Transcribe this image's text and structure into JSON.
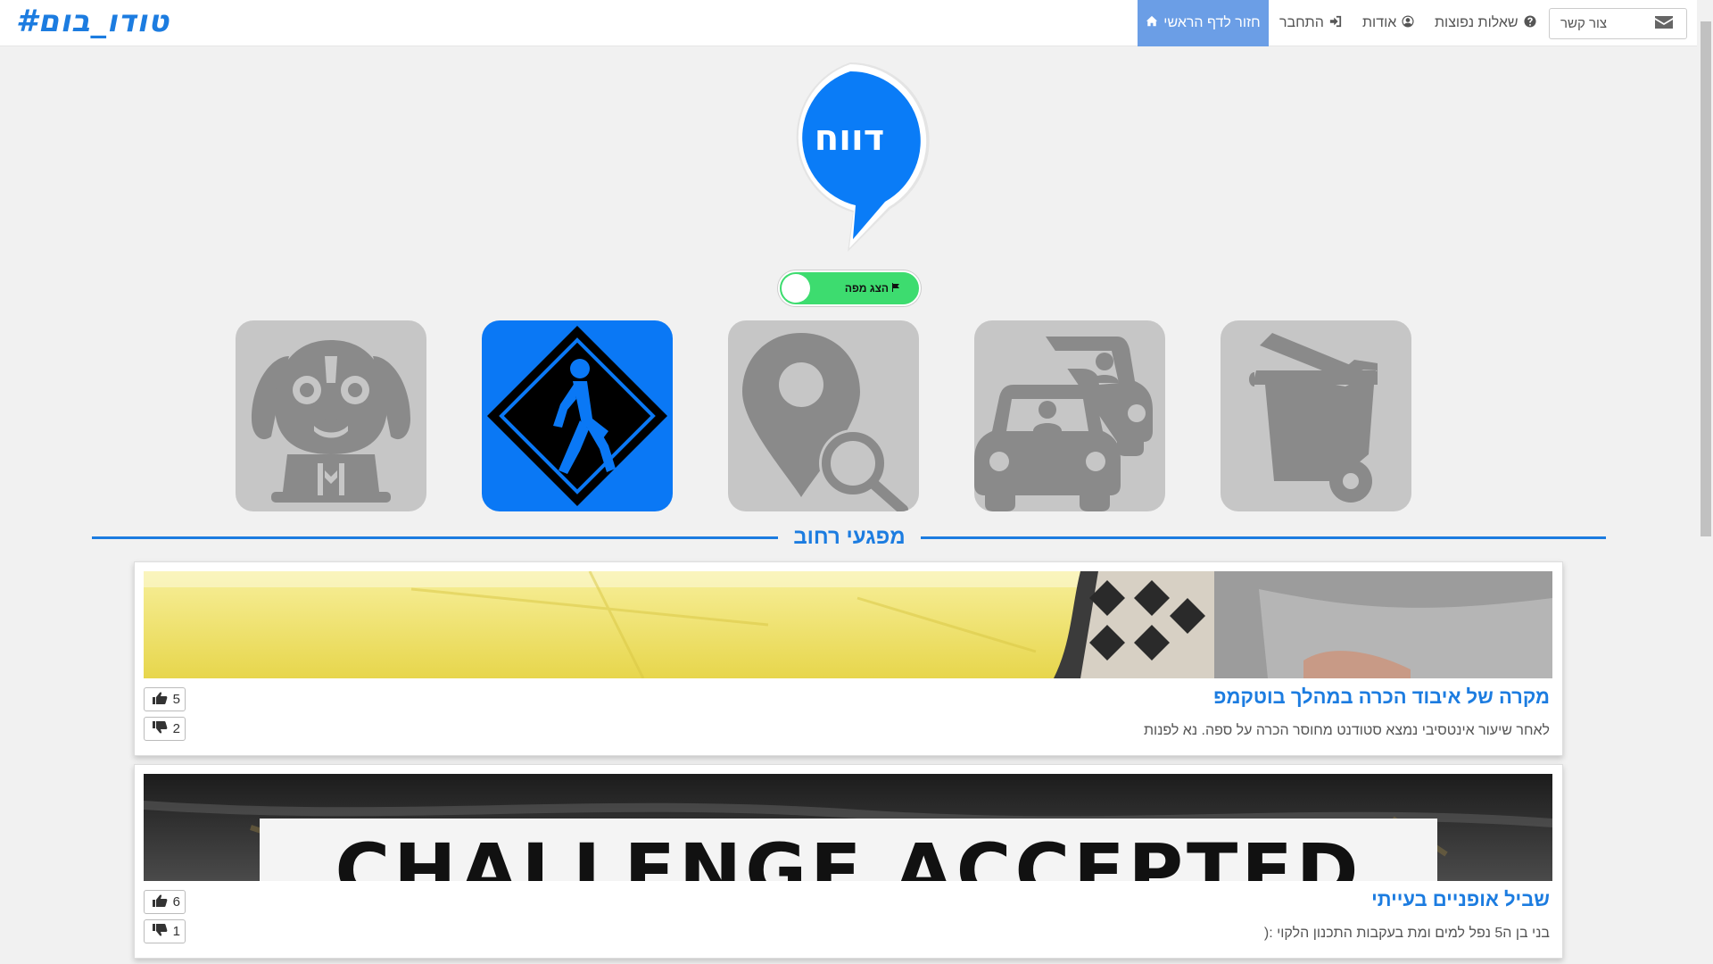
{
  "brand": {
    "logo_text": "#טודו_בום"
  },
  "nav": {
    "contact_label": "צור קשר",
    "faq_label": "שאלות נפוצות",
    "about_label": "אודות",
    "login_label": "התחבר",
    "home_label": "חזור לדף הראשי"
  },
  "hero": {
    "bubble_text": "דווח",
    "map_toggle_label": "הצג מפה",
    "map_toggle_on": false
  },
  "categories": [
    {
      "name": "dog",
      "icon": "dog-icon",
      "active": false
    },
    {
      "name": "pedestrian",
      "icon": "pedestrian-sign-icon",
      "active": true
    },
    {
      "name": "location",
      "icon": "location-search-icon",
      "active": false
    },
    {
      "name": "traffic",
      "icon": "cars-icon",
      "active": false
    },
    {
      "name": "trash",
      "icon": "trash-bin-icon",
      "active": false
    }
  ],
  "section": {
    "title": "מפגעי רחוב"
  },
  "reports": [
    {
      "title": "מקרה של איבוד הכרה במהלך בוטקמפ",
      "description": "לאחר שיעור אינטסיבי נמצא סטודנט מחוסר הכרה על ספה. נא לפנות",
      "likes": "5",
      "dislikes": "2"
    },
    {
      "title": "שביל אופניים בעייתי",
      "description": "בני בן ה5 נפל למים ומת בעקבות התכנון הלקוי :(",
      "likes": "6",
      "dislikes": "1",
      "image_caption": "CHALLENGE ACCEPTED"
    }
  ],
  "colors": {
    "accent": "#1c7ce0",
    "active_category": "#0a78f5",
    "inactive_category": "#c6c6c6",
    "toggle": "#3ddc6f"
  }
}
